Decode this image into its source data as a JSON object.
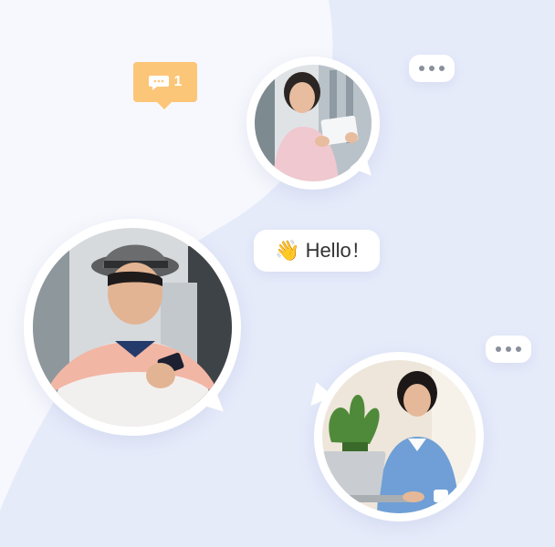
{
  "message_badge": {
    "count": "1",
    "icon": "chat-bubble-icon"
  },
  "hello_bubble": {
    "emoji": "👋",
    "text": "Hello",
    "punct": "!"
  },
  "photos": [
    {
      "name": "woman-with-tablet"
    },
    {
      "name": "man-with-phone"
    },
    {
      "name": "woman-with-laptop"
    }
  ],
  "colors": {
    "accent_badge": "#fcc679",
    "wave": "#e3e9fb",
    "background": "#f7f8fd"
  }
}
